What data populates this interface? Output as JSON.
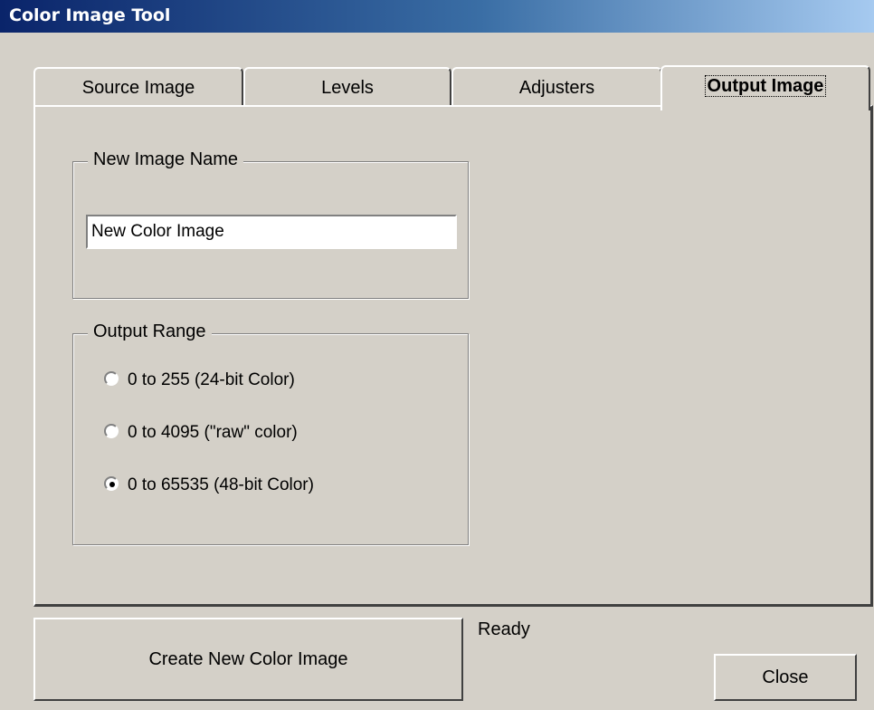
{
  "window": {
    "title": "Color Image Tool"
  },
  "tabs": [
    {
      "label": "Source Image",
      "active": false
    },
    {
      "label": "Levels",
      "active": false
    },
    {
      "label": "Adjusters",
      "active": false
    },
    {
      "label": "Output Image",
      "active": true
    }
  ],
  "new_image_name": {
    "legend": "New Image Name",
    "value": "New Color Image"
  },
  "output_range": {
    "legend": "Output Range",
    "options": [
      {
        "label": "0 to 255  (24-bit Color)",
        "checked": false
      },
      {
        "label": "0 to 4095  (\"raw\" color)",
        "checked": false
      },
      {
        "label": "0 to 65535  (48-bit Color)",
        "checked": true
      }
    ]
  },
  "buttons": {
    "create": "Create New Color Image",
    "close": "Close"
  },
  "status": "Ready",
  "icons": {
    "cursor": "mouse-pointer-icon"
  }
}
